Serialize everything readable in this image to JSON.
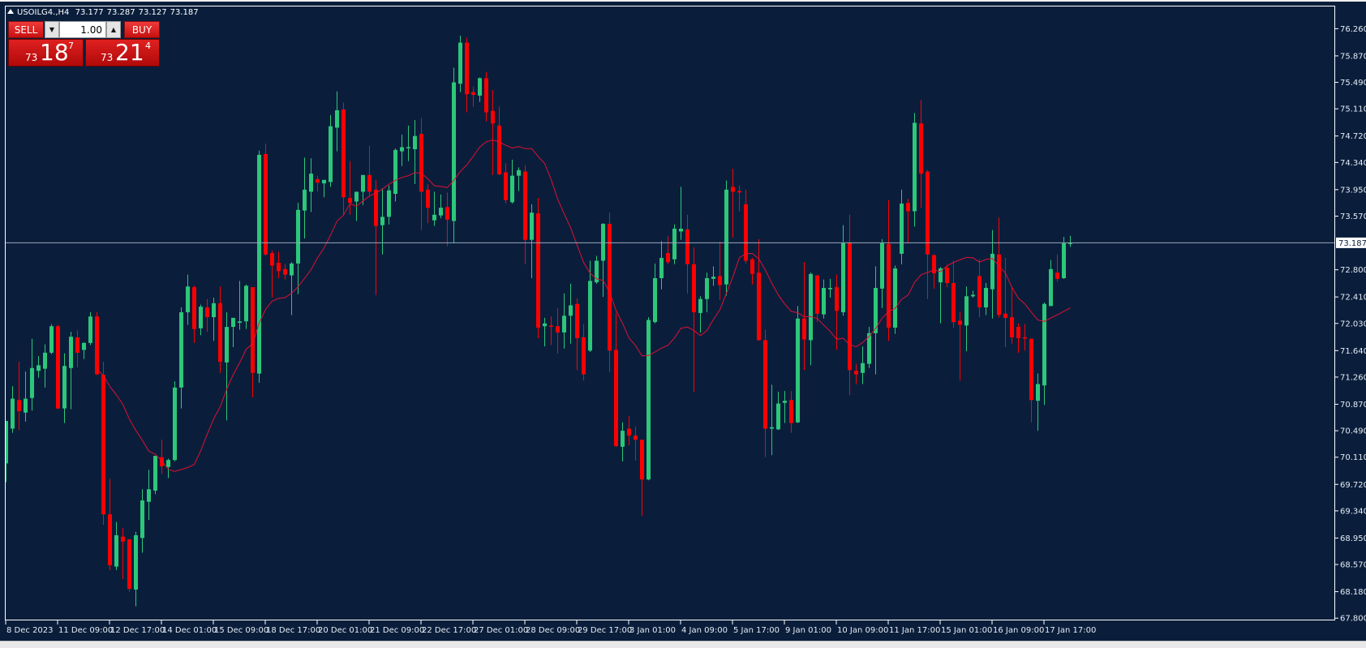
{
  "header": {
    "symbol": "USOILG4.,H4",
    "open": "73.177",
    "high": "73.287",
    "low": "73.127",
    "close": "73.187"
  },
  "trade_panel": {
    "sell_label": "SELL",
    "buy_label": "BUY",
    "lot_value": "1.00",
    "sell_price": {
      "prefix": "73",
      "big": "18",
      "sup": "7"
    },
    "buy_price": {
      "prefix": "73",
      "big": "21",
      "sup": "4"
    }
  },
  "colors": {
    "background": "#0a1e3c",
    "bull": "#2dc77a",
    "bear": "#ff0000",
    "ma": "#e01030",
    "price_line": "#9aa8b8"
  },
  "chart_data": {
    "type": "candlestick",
    "timeframe": "H4",
    "ma_period": 15,
    "current_price": "73.187",
    "ylim": [
      67.8,
      76.26
    ],
    "y_ticks": [
      "76.260",
      "75.870",
      "75.490",
      "75.110",
      "74.720",
      "74.340",
      "73.950",
      "73.570",
      "72.800",
      "72.410",
      "72.030",
      "71.640",
      "71.260",
      "70.870",
      "70.490",
      "70.110",
      "69.720",
      "69.340",
      "68.950",
      "68.570",
      "68.180",
      "67.800"
    ],
    "x_labels": [
      "8 Dec 2023",
      "11 Dec 09:00",
      "12 Dec 17:00",
      "14 Dec 01:00",
      "15 Dec 09:00",
      "18 Dec 17:00",
      "20 Dec 01:00",
      "21 Dec 09:00",
      "22 Dec 17:00",
      "27 Dec 01:00",
      "28 Dec 09:00",
      "29 Dec 17:00",
      "3 Jan 01:00",
      "4 Jan 09:00",
      "5 Jan 17:00",
      "9 Jan 01:00",
      "10 Jan 09:00",
      "11 Jan 17:00",
      "15 Jan 01:00",
      "16 Jan 09:00",
      "17 Jan 17:00"
    ],
    "x_label_every_bars": 8,
    "ohlc": [
      [
        70.02,
        70.63,
        69.75,
        70.63
      ],
      [
        70.52,
        71.13,
        70.46,
        70.95
      ],
      [
        70.93,
        71.48,
        70.5,
        70.77
      ],
      [
        70.75,
        71.34,
        70.62,
        70.95
      ],
      [
        70.96,
        71.81,
        70.78,
        71.39
      ],
      [
        71.35,
        71.56,
        71.25,
        71.43
      ],
      [
        71.38,
        71.73,
        71.11,
        71.61
      ],
      [
        71.61,
        72.02,
        71.59,
        71.99
      ],
      [
        71.99,
        72.01,
        70.8,
        70.81
      ],
      [
        70.81,
        71.6,
        70.6,
        71.42
      ],
      [
        71.39,
        71.91,
        70.8,
        71.84
      ],
      [
        71.83,
        71.93,
        71.4,
        71.61
      ],
      [
        71.65,
        71.76,
        71.52,
        71.75
      ],
      [
        71.75,
        72.19,
        71.72,
        72.13
      ],
      [
        72.13,
        72.19,
        71.29,
        71.3
      ],
      [
        71.29,
        71.48,
        69.14,
        69.29
      ],
      [
        69.29,
        69.8,
        68.49,
        68.56
      ],
      [
        68.54,
        69.18,
        68.49,
        68.99
      ],
      [
        68.97,
        69.09,
        68.36,
        68.9
      ],
      [
        68.93,
        68.93,
        68.18,
        68.22
      ],
      [
        68.21,
        69.04,
        67.97,
        68.99
      ],
      [
        68.95,
        69.65,
        68.74,
        69.49
      ],
      [
        69.47,
        69.93,
        69.21,
        69.65
      ],
      [
        69.63,
        70.13,
        69.58,
        70.13
      ],
      [
        70.11,
        70.36,
        69.87,
        69.98
      ],
      [
        69.97,
        70.09,
        69.81,
        70.07
      ],
      [
        70.07,
        71.2,
        70.05,
        71.11
      ],
      [
        71.11,
        72.26,
        70.81,
        72.19
      ],
      [
        72.19,
        72.73,
        72.01,
        72.56
      ],
      [
        72.55,
        72.57,
        71.75,
        71.95
      ],
      [
        71.96,
        72.3,
        71.86,
        72.27
      ],
      [
        72.26,
        72.38,
        71.91,
        72.12
      ],
      [
        72.12,
        72.4,
        71.78,
        72.32
      ],
      [
        72.32,
        72.56,
        71.32,
        71.48
      ],
      [
        71.47,
        72.19,
        70.64,
        71.98
      ],
      [
        71.98,
        72.11,
        71.69,
        72.11
      ],
      [
        72.04,
        72.64,
        71.94,
        72.06
      ],
      [
        72.06,
        72.59,
        71.95,
        72.57
      ],
      [
        72.55,
        72.55,
        70.97,
        71.32
      ],
      [
        71.31,
        74.51,
        71.18,
        74.45
      ],
      [
        74.46,
        74.61,
        73.0,
        73.02
      ],
      [
        73.04,
        73.08,
        72.4,
        72.86
      ],
      [
        72.9,
        73.06,
        72.68,
        72.78
      ],
      [
        72.81,
        72.88,
        72.66,
        72.73
      ],
      [
        72.72,
        72.91,
        72.15,
        72.89
      ],
      [
        72.89,
        73.76,
        72.45,
        73.66
      ],
      [
        73.65,
        74.41,
        73.25,
        73.95
      ],
      [
        73.92,
        74.4,
        73.63,
        74.18
      ],
      [
        74.1,
        74.15,
        73.92,
        74.05
      ],
      [
        74.04,
        74.09,
        73.84,
        74.09
      ],
      [
        74.06,
        75.02,
        73.99,
        74.86
      ],
      [
        74.84,
        75.36,
        74.5,
        75.09
      ],
      [
        75.1,
        75.2,
        73.59,
        73.84
      ],
      [
        73.83,
        74.36,
        73.59,
        73.76
      ],
      [
        73.78,
        73.92,
        73.5,
        73.92
      ],
      [
        73.92,
        74.16,
        73.73,
        74.16
      ],
      [
        74.16,
        74.58,
        73.85,
        73.92
      ],
      [
        73.95,
        74.09,
        72.44,
        73.43
      ],
      [
        73.44,
        73.97,
        73.02,
        73.56
      ],
      [
        73.56,
        74.01,
        73.45,
        73.94
      ],
      [
        73.89,
        74.54,
        73.78,
        74.52
      ],
      [
        74.5,
        74.74,
        74.29,
        74.56
      ],
      [
        74.55,
        74.87,
        74.36,
        74.56
      ],
      [
        74.53,
        74.95,
        74.03,
        74.72
      ],
      [
        74.75,
        74.98,
        73.37,
        73.92
      ],
      [
        73.95,
        74.03,
        73.47,
        73.69
      ],
      [
        73.51,
        73.92,
        73.43,
        73.59
      ],
      [
        73.58,
        73.88,
        73.54,
        73.69
      ],
      [
        73.7,
        73.91,
        73.14,
        73.52
      ],
      [
        73.5,
        75.7,
        73.18,
        75.49
      ],
      [
        75.47,
        76.16,
        75.35,
        76.06
      ],
      [
        76.06,
        76.13,
        75.06,
        75.32
      ],
      [
        75.35,
        75.43,
        75.14,
        75.31
      ],
      [
        75.3,
        75.56,
        75.21,
        75.55
      ],
      [
        75.55,
        75.64,
        74.93,
        75.06
      ],
      [
        75.08,
        75.38,
        74.16,
        74.9
      ],
      [
        74.87,
        75.14,
        74.16,
        74.17
      ],
      [
        74.2,
        74.33,
        73.75,
        73.8
      ],
      [
        73.77,
        74.38,
        73.75,
        74.15
      ],
      [
        74.15,
        74.27,
        73.93,
        74.23
      ],
      [
        74.21,
        74.3,
        72.88,
        73.23
      ],
      [
        73.23,
        73.74,
        72.68,
        73.62
      ],
      [
        73.61,
        73.83,
        71.82,
        71.97
      ],
      [
        71.99,
        72.11,
        71.7,
        72.03
      ],
      [
        72.0,
        72.13,
        71.72,
        71.99
      ],
      [
        71.99,
        72.25,
        71.6,
        71.9
      ],
      [
        71.9,
        72.46,
        71.67,
        72.14
      ],
      [
        72.14,
        72.6,
        71.74,
        72.29
      ],
      [
        72.31,
        72.39,
        71.36,
        71.82
      ],
      [
        71.83,
        72.02,
        71.21,
        71.3
      ],
      [
        71.64,
        72.93,
        71.62,
        72.64
      ],
      [
        72.62,
        73.0,
        72.6,
        72.93
      ],
      [
        72.93,
        73.47,
        72.41,
        73.46
      ],
      [
        73.46,
        73.62,
        71.33,
        71.64
      ],
      [
        71.65,
        72.18,
        70.26,
        70.27
      ],
      [
        70.26,
        70.61,
        70.05,
        70.49
      ],
      [
        70.52,
        70.7,
        70.28,
        70.42
      ],
      [
        70.42,
        70.55,
        70.06,
        70.36
      ],
      [
        70.36,
        70.36,
        69.27,
        69.79
      ],
      [
        69.79,
        72.12,
        69.78,
        72.08
      ],
      [
        72.05,
        72.89,
        72.03,
        72.68
      ],
      [
        72.68,
        73.21,
        72.52,
        72.97
      ],
      [
        73.04,
        73.28,
        72.88,
        72.91
      ],
      [
        72.95,
        73.45,
        72.88,
        73.39
      ],
      [
        73.35,
        73.99,
        73.23,
        73.39
      ],
      [
        73.38,
        73.59,
        72.46,
        72.88
      ],
      [
        72.88,
        73.12,
        71.05,
        72.19
      ],
      [
        72.18,
        72.42,
        71.9,
        72.38
      ],
      [
        72.38,
        72.76,
        72.19,
        72.68
      ],
      [
        72.67,
        72.85,
        72.57,
        72.7
      ],
      [
        72.71,
        73.2,
        72.37,
        72.58
      ],
      [
        72.59,
        74.08,
        72.43,
        73.95
      ],
      [
        73.99,
        74.25,
        73.26,
        73.92
      ],
      [
        73.93,
        74.01,
        73.64,
        73.91
      ],
      [
        73.74,
        73.95,
        72.89,
        72.93
      ],
      [
        72.95,
        72.97,
        72.59,
        72.74
      ],
      [
        72.76,
        73.24,
        71.78,
        71.79
      ],
      [
        71.79,
        71.94,
        70.11,
        70.52
      ],
      [
        70.52,
        71.15,
        70.14,
        70.54
      ],
      [
        70.51,
        71.05,
        70.5,
        70.88
      ],
      [
        70.89,
        71.06,
        70.6,
        70.92
      ],
      [
        70.93,
        71.06,
        70.46,
        70.6
      ],
      [
        70.61,
        72.28,
        70.6,
        72.1
      ],
      [
        72.1,
        72.91,
        71.36,
        71.8
      ],
      [
        71.79,
        72.76,
        71.43,
        72.74
      ],
      [
        72.72,
        72.72,
        72.05,
        72.17
      ],
      [
        72.16,
        72.66,
        72.1,
        72.54
      ],
      [
        72.52,
        72.67,
        72.4,
        72.54
      ],
      [
        72.55,
        72.73,
        71.65,
        72.21
      ],
      [
        72.19,
        73.44,
        72.14,
        73.18
      ],
      [
        73.19,
        73.59,
        71.0,
        71.36
      ],
      [
        71.35,
        71.45,
        71.16,
        71.3
      ],
      [
        71.32,
        71.7,
        71.16,
        71.46
      ],
      [
        71.45,
        71.98,
        71.39,
        71.89
      ],
      [
        71.89,
        72.85,
        71.3,
        72.54
      ],
      [
        72.53,
        73.24,
        72.25,
        73.18
      ],
      [
        73.17,
        73.8,
        71.78,
        71.97
      ],
      [
        71.97,
        72.86,
        71.88,
        72.82
      ],
      [
        73.03,
        73.95,
        72.88,
        73.75
      ],
      [
        73.76,
        73.82,
        73.19,
        73.64
      ],
      [
        73.64,
        75.05,
        73.42,
        74.91
      ],
      [
        74.9,
        75.24,
        73.69,
        74.18
      ],
      [
        74.21,
        74.23,
        72.38,
        73.02
      ],
      [
        73.01,
        73.02,
        72.53,
        72.75
      ],
      [
        72.62,
        72.84,
        72.03,
        72.82
      ],
      [
        72.83,
        72.87,
        72.55,
        72.61
      ],
      [
        72.61,
        72.93,
        71.97,
        72.05
      ],
      [
        72.07,
        72.2,
        71.21,
        72.01
      ],
      [
        72.0,
        72.56,
        71.63,
        72.42
      ],
      [
        72.42,
        72.5,
        72.4,
        72.44
      ],
      [
        72.71,
        72.95,
        72.12,
        72.26
      ],
      [
        72.26,
        72.61,
        72.15,
        72.54
      ],
      [
        72.52,
        73.37,
        72.1,
        73.03
      ],
      [
        73.02,
        73.55,
        72.11,
        72.15
      ],
      [
        72.17,
        72.97,
        71.69,
        72.11
      ],
      [
        72.12,
        72.56,
        71.74,
        71.83
      ],
      [
        71.98,
        72.03,
        71.61,
        71.82
      ],
      [
        71.83,
        72.02,
        71.64,
        71.82
      ],
      [
        71.81,
        71.81,
        70.61,
        70.93
      ],
      [
        70.92,
        71.31,
        70.49,
        71.16
      ],
      [
        71.14,
        72.33,
        70.86,
        72.31
      ],
      [
        72.28,
        72.94,
        72.28,
        72.81
      ],
      [
        72.76,
        73.02,
        72.63,
        72.67
      ],
      [
        72.68,
        73.27,
        72.67,
        73.18
      ],
      [
        73.177,
        73.287,
        73.127,
        73.187
      ]
    ]
  }
}
